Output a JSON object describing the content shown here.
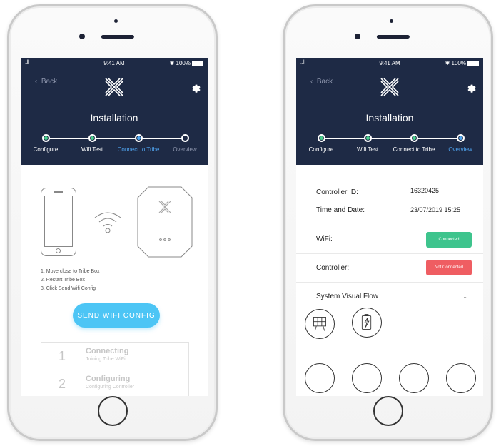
{
  "status_bar": {
    "signal": "..ll",
    "time": "9:41 AM",
    "battery": "100%"
  },
  "nav": {
    "back_label": "Back",
    "title": "Installation"
  },
  "steps": [
    "Configure",
    "Wifi Test",
    "Connect to Tribe",
    "Overview"
  ],
  "left": {
    "instructions": [
      "1. Move close to Tribe Box",
      "2. Restart Tribe Box",
      "3. Click Send Wifi Config"
    ],
    "send_button": "SEND WIFI CONFIG",
    "progress": [
      {
        "num": "1",
        "title": "Connecting",
        "subtitle": "Joining Tribe WiFi"
      },
      {
        "num": "2",
        "title": "Configuring",
        "subtitle": "Configuring Controller"
      }
    ]
  },
  "right": {
    "controller_id_label": "Controller ID:",
    "controller_id_value": "16320425",
    "time_date_label": "Time and Date:",
    "time_date_value": "23/07/2019 15:25",
    "wifi_label": "WiFi:",
    "wifi_status": "Connected",
    "controller_label": "Controller:",
    "controller_status": "Not Connected",
    "flow_label": "System Visual Flow"
  },
  "colors": {
    "header": "#1e2a45",
    "done": "#4bd18f",
    "active": "#52a9f2",
    "button": "#4cc5f5",
    "connected": "#3ec48d",
    "not_connected": "#ef5d62"
  }
}
